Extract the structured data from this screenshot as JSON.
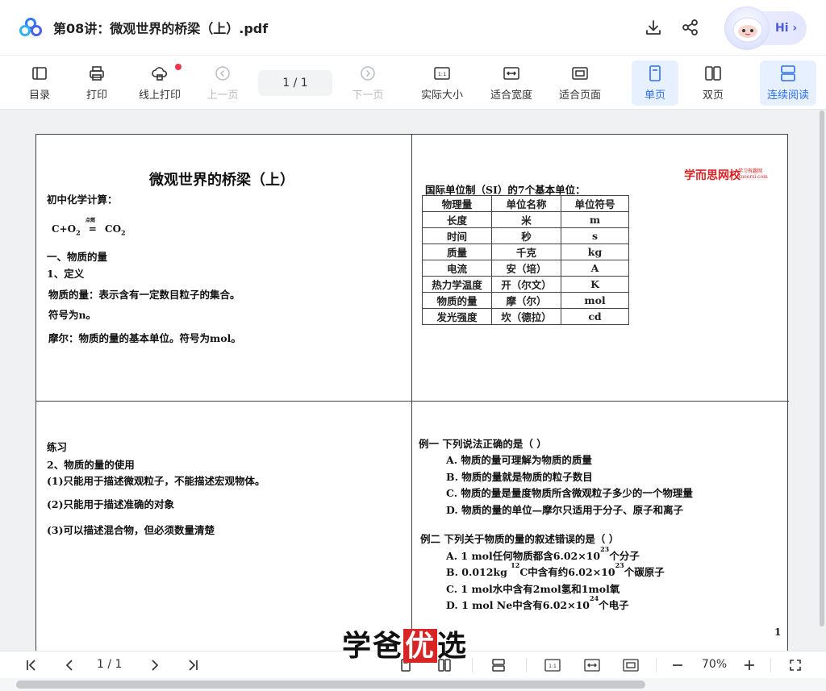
{
  "window": {
    "title": "第08讲：微观世界的桥梁（上）.pdf",
    "hi_label": "Hi"
  },
  "toolbar": {
    "toc": "目录",
    "print": "打印",
    "online_print": "线上打印",
    "prev_page": "上一页",
    "page_indicator": "1  / 1",
    "next_page": "下一页",
    "actual_size": "实际大小",
    "fit_width": "适合宽度",
    "fit_page": "适合页面",
    "single_page": "单页",
    "double_page": "双页",
    "continuous": "连续阅读",
    "active_view": "单页",
    "accent_color": "#2b6ff0"
  },
  "document": {
    "title": "微观世界的桥梁（上）",
    "brand": "学而思网校",
    "brand_small": "学习有趣网 xueersi.com",
    "q1": {
      "calc_heading": "初中化学计算：",
      "equation_lhs": "C+O",
      "equation_sub": "2",
      "equation_cond": "点燃",
      "equation_eq": "=",
      "equation_rhs": "CO",
      "equation_rhs_sub": "2",
      "section1": "一、物质的量",
      "def": "1、定义",
      "def_text": "物质的量：表示含有一定数目粒子的集合。",
      "symbol": "符号为n。",
      "mol": "摩尔：物质的量的基本单位。符号为mol。"
    },
    "q2": {
      "heading": "国际单位制（SI）的7个基本单位：",
      "headers": [
        "物理量",
        "单位名称",
        "单位符号"
      ],
      "rows": [
        [
          "长度",
          "米",
          "m"
        ],
        [
          "时间",
          "秒",
          "s"
        ],
        [
          "质量",
          "千克",
          "kg"
        ],
        [
          "电流",
          "安（培）",
          "A"
        ],
        [
          "热力学温度",
          "开（尔文）",
          "K"
        ],
        [
          "物质的量",
          "摩（尔）",
          "mol"
        ],
        [
          "发光强度",
          "坎（德拉）",
          "cd"
        ]
      ]
    },
    "q3": {
      "practice": "练习",
      "use_heading": "2、物质的量的使用",
      "u1": "(1)只能用于描述微观粒子，不能描述宏观物体。",
      "u2": "(2)只能用于描述准确的对象",
      "u3": "(3)可以描述混合物，但必须数量清楚"
    },
    "q4": {
      "ex1": "例一  下列说法正确的是（   ）",
      "ex1_a": "A.  物质的量可理解为物质的质量",
      "ex1_b": "B.  物质的量就是物质的粒子数目",
      "ex1_c": "C.  物质的量是量度物质所含微观粒子多少的一个物理量",
      "ex1_d": "D.  物质的量的单位—摩尔只适用于分子、原子和离子",
      "ex2": "例二 下列关于物质的量的叙述错误的是（ ）",
      "ex2_a_pre": "A.  1 mol任何物质都含6.02×10",
      "ex2_a_sup": "23",
      "ex2_a_post": "个分子",
      "ex2_b_pre": "B.  0.012kg ",
      "ex2_b_sup1": "12",
      "ex2_b_mid": "C中含有约6.02×10",
      "ex2_b_sup2": "23",
      "ex2_b_post": "个碳原子",
      "ex2_c": "C.  1 mol水中含有2mol氢和1mol氧",
      "ex2_d_pre": "D.  1 mol Ne中含有6.02×10",
      "ex2_d_sup": "24",
      "ex2_d_post": "个电子"
    },
    "page_number": "1"
  },
  "watermark": {
    "pre": "学爸",
    "highlight": "优",
    "post": "选"
  },
  "bottombar": {
    "page_indicator": "1  / 1",
    "zoom": "70%"
  }
}
